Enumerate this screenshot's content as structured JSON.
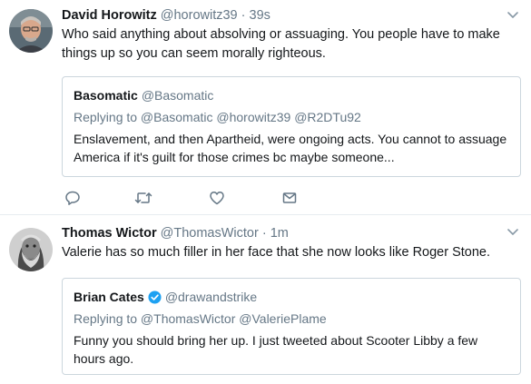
{
  "tweets": [
    {
      "name": "David Horowitz",
      "handle": "@horowitz39",
      "separator": "·",
      "time": "39s",
      "text": "Who said anything about absolving or assuaging. You people have to make things up so you can seem morally righteous.",
      "avatar_icon": "avatar-photo-icon",
      "quote": {
        "name": "Basomatic",
        "handle": "@Basomatic",
        "replying": "Replying to @Basomatic @horowitz39 @R2DTu92",
        "text": "Enslavement, and then Apartheid, were ongoing acts.  You cannot to assuage America if it's guilt for those crimes bc maybe someone..."
      },
      "actions": [
        "reply-icon",
        "retweet-icon",
        "like-icon",
        "direct-message-icon"
      ]
    },
    {
      "name": "Thomas Wictor",
      "handle": "@ThomasWictor",
      "separator": "·",
      "time": "1m",
      "text": "Valerie has so much filler in her face that she now looks like Roger Stone.",
      "avatar_icon": "avatar-photo-icon",
      "quote": {
        "name": "Brian Cates",
        "handle": "@drawandstrike",
        "verified": true,
        "replying": "Replying to @ThomasWictor @ValeriePlame",
        "text": "Funny you should bring her up. I just tweeted about Scooter Libby a few hours ago."
      }
    }
  ],
  "colors": {
    "text": "#14171a",
    "secondary": "#657786",
    "border": "#e6ecf0",
    "quote_border": "#ccd6dd",
    "verified": "#1da1f2"
  }
}
